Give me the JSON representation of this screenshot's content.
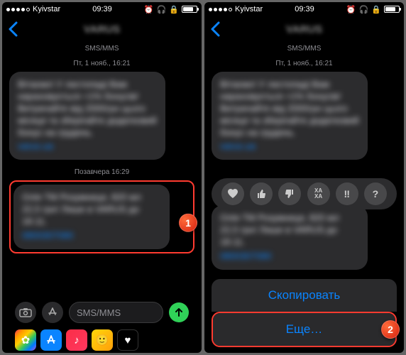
{
  "status": {
    "carrier": "Kyivstar",
    "time": "09:39"
  },
  "header": {
    "contact": "VARUS"
  },
  "thread": {
    "protocol": "SMS/MMS",
    "date1": "Пт, 1 нояб., 16:21",
    "msg1_text": "Вітаємо! У листопаді Вам нараховується +1% бонусів! Витрачайте від 2000грн цього місяця та зберігайте додатковий бонус на грудень.",
    "msg1_link": "varus.ua",
    "date2": "Позавчера 16:29",
    "msg2_text": "Олія ТМ Розумниця, 820 мл  22,5 грн! Лише в VARUS до 18.11.",
    "msg2_link": "0800307080"
  },
  "input": {
    "placeholder": "SMS/MMS"
  },
  "reactions": {
    "haha": "ХА\nХА"
  },
  "context_menu": {
    "copy": "Скопировать",
    "more": "Еще…"
  },
  "callouts": {
    "one": "1",
    "two": "2"
  }
}
